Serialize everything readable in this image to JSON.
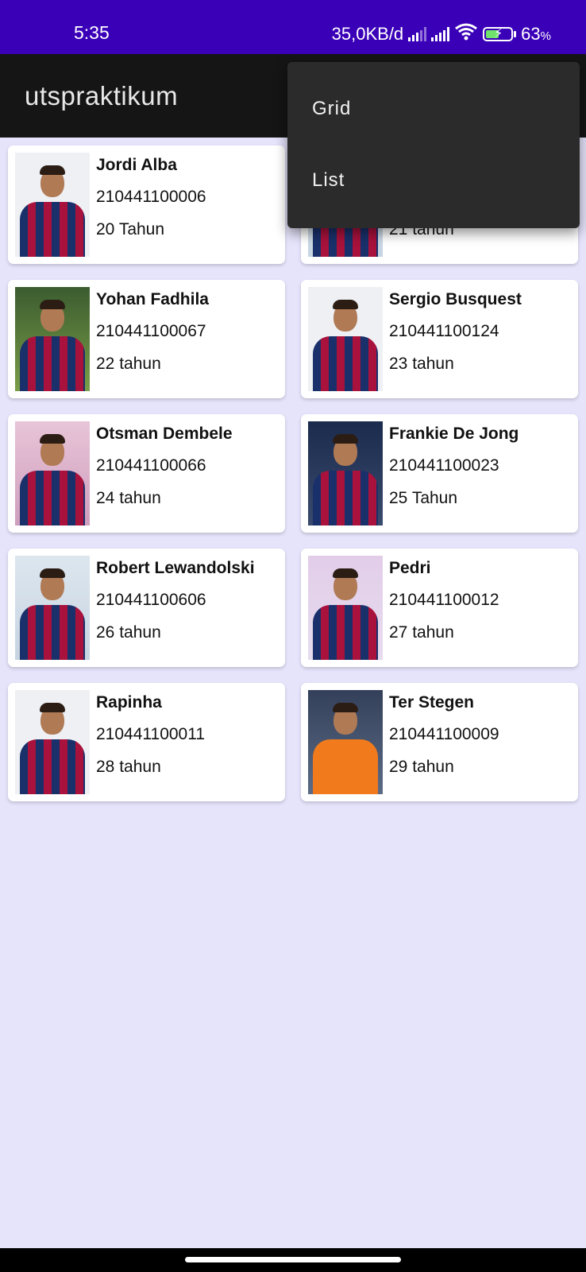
{
  "status_bar": {
    "time": "5:35",
    "net_speed": "35,0KB/d",
    "battery_percent": "63",
    "battery_unit": "%",
    "icons": [
      "signal-icon",
      "signal-icon",
      "wifi-icon",
      "battery-charging-icon"
    ]
  },
  "app_bar": {
    "title": "utspraktikum"
  },
  "menu": {
    "items": [
      {
        "label": "Grid"
      },
      {
        "label": "List"
      }
    ]
  },
  "players": [
    {
      "name": "Jordi Alba",
      "nim": "210441100006",
      "age": "20 Tahun"
    },
    {
      "name": "",
      "nim": "",
      "age": "21 tahun"
    },
    {
      "name": "Yohan Fadhila",
      "nim": "210441100067",
      "age": "22 tahun"
    },
    {
      "name": "Sergio Busquest",
      "nim": "210441100124",
      "age": "23 tahun"
    },
    {
      "name": "Otsman Dembele",
      "nim": "210441100066",
      "age": "24 tahun"
    },
    {
      "name": "Frankie De Jong",
      "nim": "210441100023",
      "age": "25 Tahun"
    },
    {
      "name": "Robert Lewandolski",
      "nim": "210441100606",
      "age": "26 tahun"
    },
    {
      "name": "Pedri",
      "nim": "210441100012",
      "age": "27 tahun"
    },
    {
      "name": "Rapinha",
      "nim": "210441100011",
      "age": "28 tahun"
    },
    {
      "name": "Ter Stegen",
      "nim": "210441100009",
      "age": "29 tahun"
    }
  ],
  "colors": {
    "status_bar": "#3a00b8",
    "app_bar": "#151515",
    "background": "#e6e4fb",
    "popup": "#2b2b2b",
    "card": "#ffffff"
  }
}
